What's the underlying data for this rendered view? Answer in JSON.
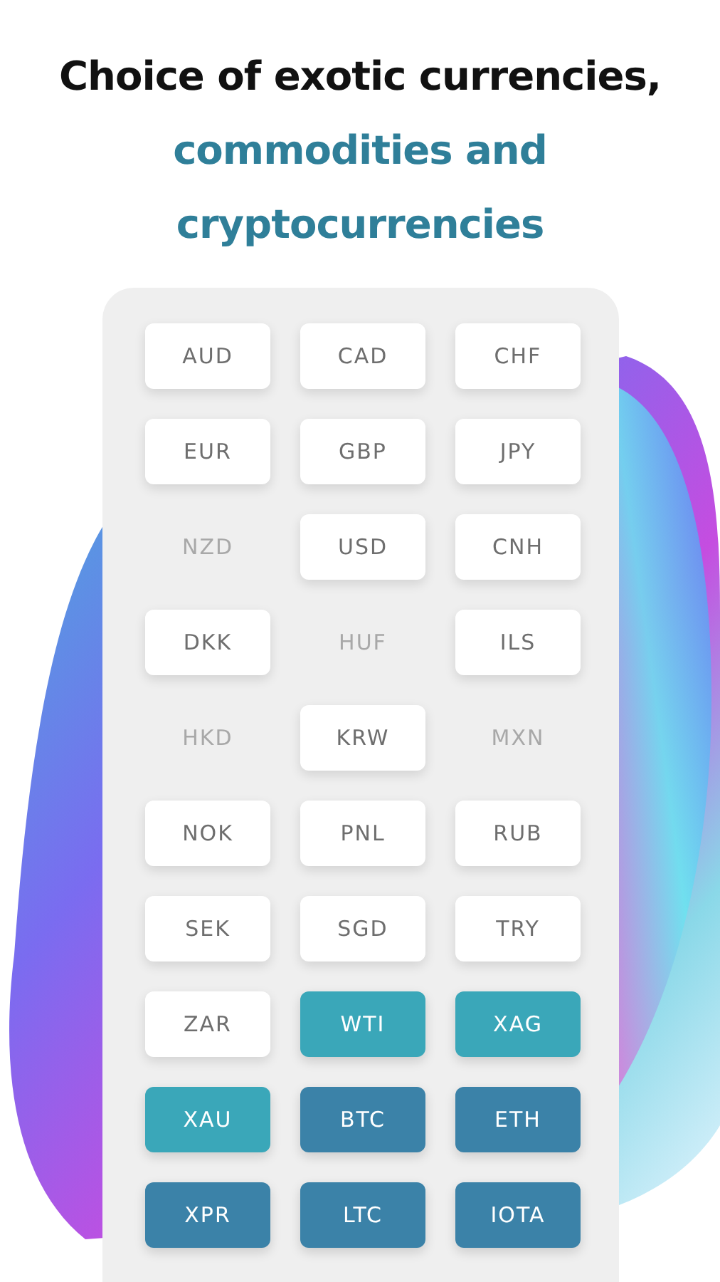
{
  "headline": [
    {
      "text": "Choice of exotic currencies,",
      "highlight": false
    },
    {
      "text": "commodities and cryptocurrencies",
      "highlight": true
    }
  ],
  "instruments": [
    {
      "label": "AUD",
      "kind": "currency",
      "disabled": false
    },
    {
      "label": "CAD",
      "kind": "currency",
      "disabled": false
    },
    {
      "label": "CHF",
      "kind": "currency",
      "disabled": false
    },
    {
      "label": "EUR",
      "kind": "currency",
      "disabled": false
    },
    {
      "label": "GBP",
      "kind": "currency",
      "disabled": false
    },
    {
      "label": "JPY",
      "kind": "currency",
      "disabled": false
    },
    {
      "label": "NZD",
      "kind": "currency",
      "disabled": true
    },
    {
      "label": "USD",
      "kind": "currency",
      "disabled": false
    },
    {
      "label": "CNH",
      "kind": "currency",
      "disabled": false
    },
    {
      "label": "DKK",
      "kind": "currency",
      "disabled": false
    },
    {
      "label": "HUF",
      "kind": "currency",
      "disabled": true
    },
    {
      "label": "ILS",
      "kind": "currency",
      "disabled": false
    },
    {
      "label": "HKD",
      "kind": "currency",
      "disabled": true
    },
    {
      "label": "KRW",
      "kind": "currency",
      "disabled": false
    },
    {
      "label": "MXN",
      "kind": "currency",
      "disabled": true
    },
    {
      "label": "NOK",
      "kind": "currency",
      "disabled": false
    },
    {
      "label": "PNL",
      "kind": "currency",
      "disabled": false
    },
    {
      "label": "RUB",
      "kind": "currency",
      "disabled": false
    },
    {
      "label": "SEK",
      "kind": "currency",
      "disabled": false
    },
    {
      "label": "SGD",
      "kind": "currency",
      "disabled": false
    },
    {
      "label": "TRY",
      "kind": "currency",
      "disabled": false
    },
    {
      "label": "ZAR",
      "kind": "currency",
      "disabled": false
    },
    {
      "label": "WTI",
      "kind": "commodity",
      "disabled": false
    },
    {
      "label": "XAG",
      "kind": "commodity",
      "disabled": false
    },
    {
      "label": "XAU",
      "kind": "commodity",
      "disabled": false
    },
    {
      "label": "BTC",
      "kind": "crypto",
      "disabled": false
    },
    {
      "label": "ETH",
      "kind": "crypto",
      "disabled": false
    },
    {
      "label": "XPR",
      "kind": "crypto",
      "disabled": false
    },
    {
      "label": "LTC",
      "kind": "crypto",
      "disabled": false
    },
    {
      "label": "IOTA",
      "kind": "crypto",
      "disabled": false
    }
  ]
}
